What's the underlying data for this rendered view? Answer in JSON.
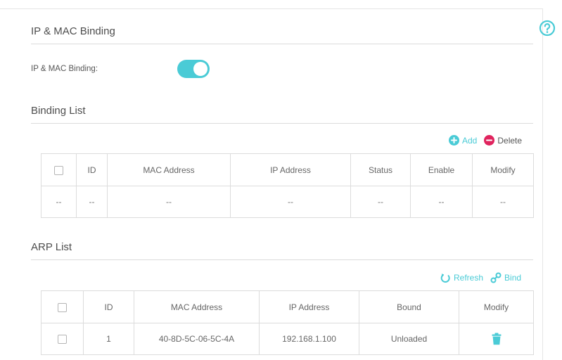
{
  "ip_mac_binding": {
    "title": "IP & MAC Binding",
    "toggle_label": "IP & MAC Binding:",
    "toggle_state": "on"
  },
  "binding_list": {
    "title": "Binding List",
    "add_label": "Add",
    "delete_label": "Delete",
    "columns": [
      "ID",
      "MAC Address",
      "IP Address",
      "Status",
      "Enable",
      "Modify"
    ],
    "empty_row": [
      "--",
      "--",
      "--",
      "--",
      "--",
      "--",
      "--"
    ]
  },
  "arp_list": {
    "title": "ARP List",
    "refresh_label": "Refresh",
    "bind_label": "Bind",
    "columns": [
      "ID",
      "MAC Address",
      "IP Address",
      "Bound",
      "Modify"
    ],
    "rows": [
      {
        "id": "1",
        "mac": "40-8D-5C-06-5C-4A",
        "ip": "192.168.1.100",
        "bound": "Unloaded",
        "modify_icon": "trash-icon"
      }
    ]
  },
  "colors": {
    "accent": "#4acbd6",
    "delete": "#e0245e",
    "border": "#dcdcdc"
  }
}
